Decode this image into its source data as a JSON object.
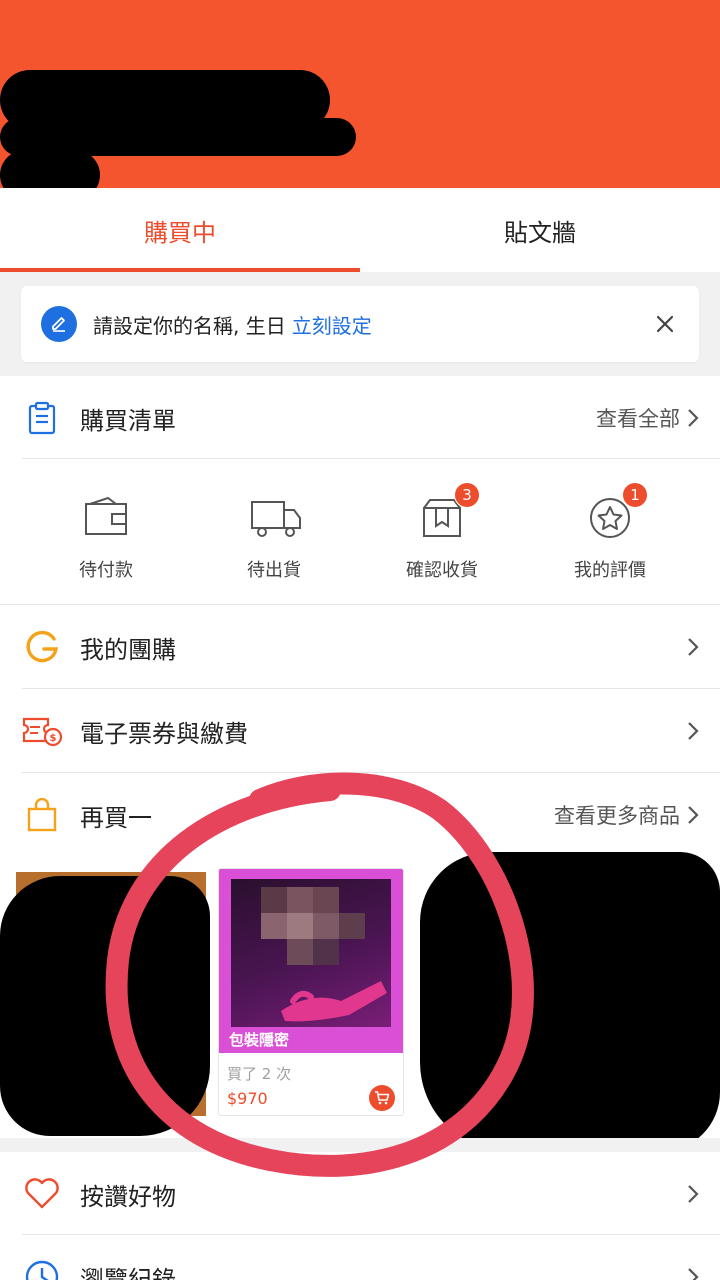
{
  "tabs": [
    {
      "label": "購買中"
    },
    {
      "label": "貼文牆"
    }
  ],
  "notice": {
    "text": "請設定你的名稱, 生日",
    "link": "立刻設定"
  },
  "purchase_list": {
    "title": "購買清單",
    "view_all": "查看全部"
  },
  "statuses": [
    {
      "label": "待付款",
      "icon": "wallet-icon"
    },
    {
      "label": "待出貨",
      "icon": "truck-icon"
    },
    {
      "label": "確認收貨",
      "icon": "box-icon",
      "badge": "3"
    },
    {
      "label": "我的評價",
      "icon": "star-icon",
      "badge": "1"
    }
  ],
  "group_buy": {
    "label": "我的團購"
  },
  "tickets": {
    "label": "電子票券與繳費"
  },
  "buy_again": {
    "title": "再買一",
    "view_more": "查看更多商品"
  },
  "product": {
    "package_label": "包裝隱密",
    "bought_text": "買了 2 次",
    "price": "$970"
  },
  "liked": {
    "label": "按讚好物"
  },
  "history": {
    "label": "瀏覽紀錄"
  },
  "colors": {
    "brand": "#ee4d2d",
    "header": "#f4552e",
    "link": "#1e6fe0",
    "annotation": "#e5445a"
  }
}
